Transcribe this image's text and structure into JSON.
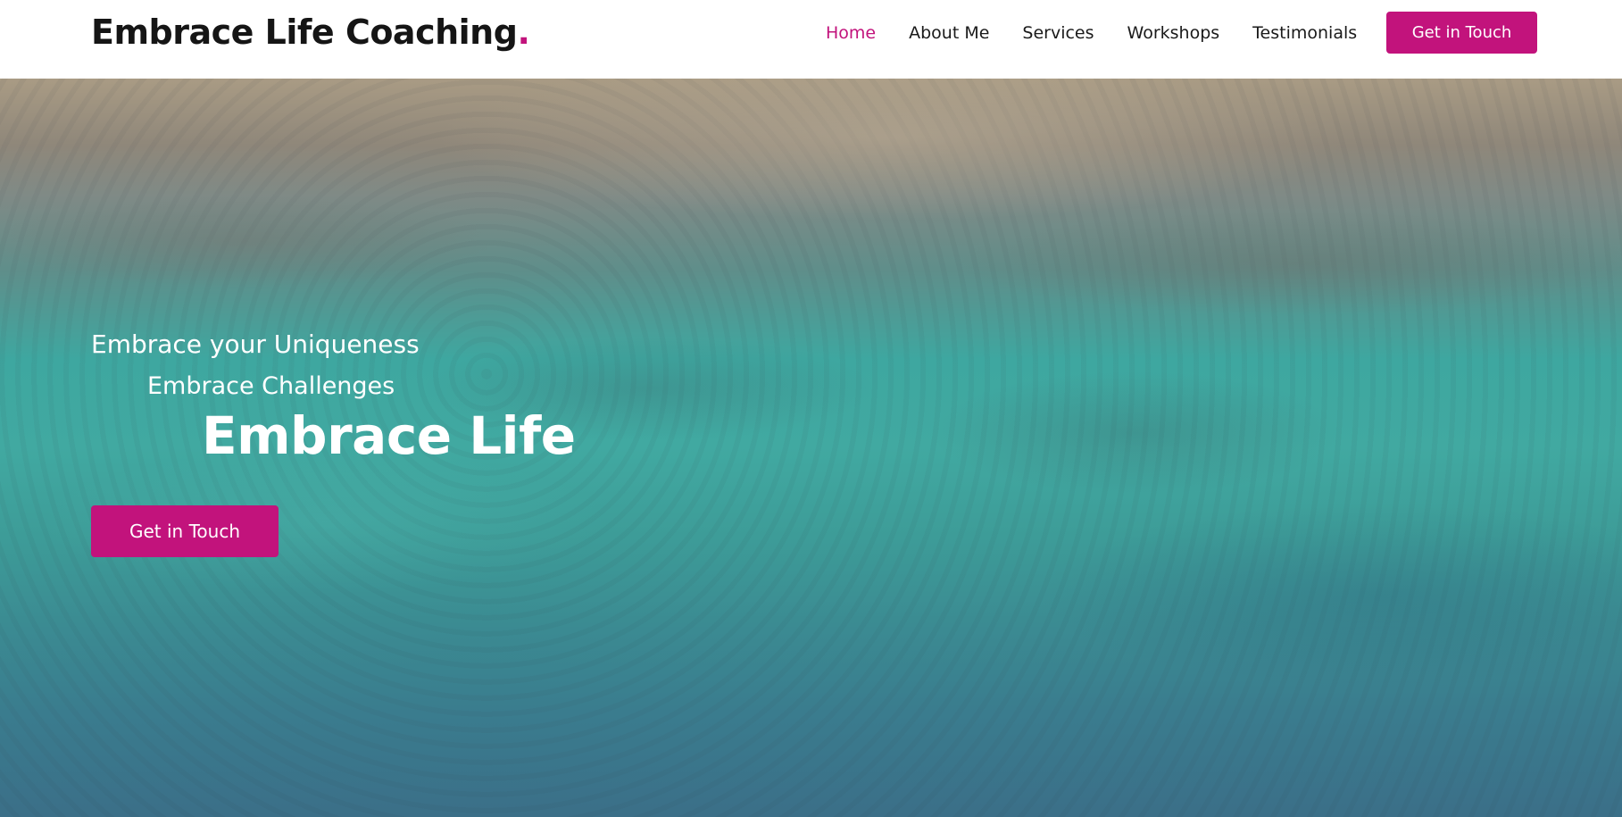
{
  "header": {
    "logo_text": "Embrace Life Coaching",
    "logo_dot": ".",
    "nav": [
      {
        "label": "Home",
        "active": true
      },
      {
        "label": "About Me",
        "active": false
      },
      {
        "label": "Services",
        "active": false
      },
      {
        "label": "Workshops",
        "active": false
      },
      {
        "label": "Testimonials",
        "active": false
      }
    ],
    "cta_label": "Get in Touch"
  },
  "hero": {
    "line1": "Embrace your Uniqueness",
    "line2": "Embrace Challenges",
    "title": "Embrace Life",
    "cta_label": "Get in Touch",
    "background": "aerial-ocean-reef-photo"
  },
  "colors": {
    "accent": "#c2137c",
    "header_bg": "#ffffff",
    "text_dark": "#151515"
  }
}
